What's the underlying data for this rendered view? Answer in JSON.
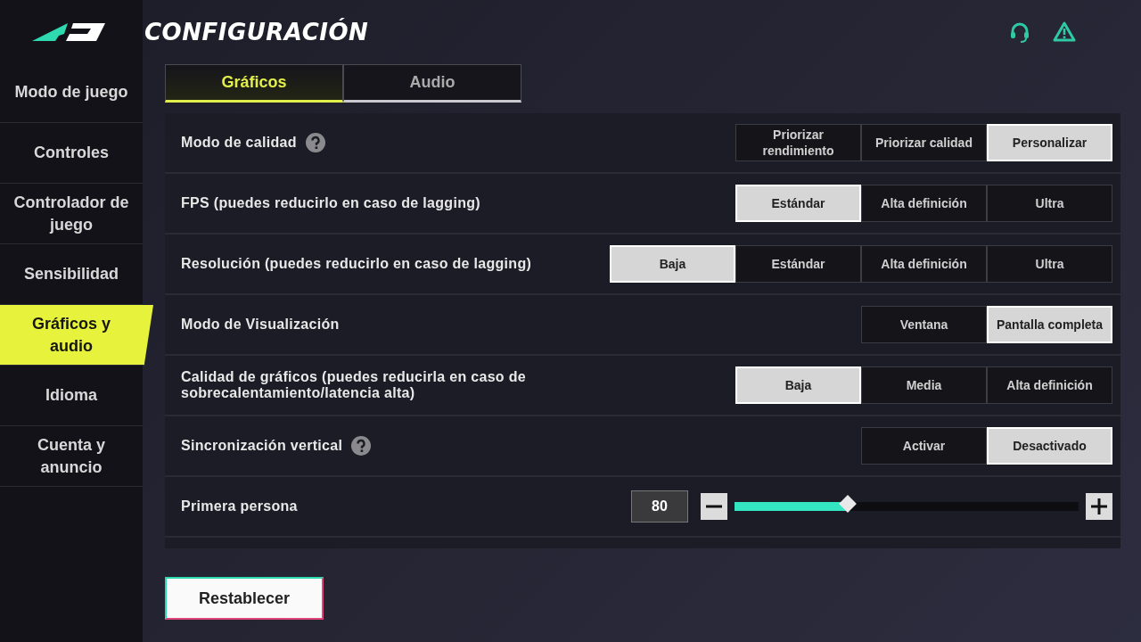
{
  "header": {
    "title": "CONFIGURACIÓN"
  },
  "sidebar": {
    "items": [
      {
        "label": "Modo de juego",
        "selected": false
      },
      {
        "label": "Controles",
        "selected": false
      },
      {
        "label": "Controlador de juego",
        "selected": false
      },
      {
        "label": "Sensibilidad",
        "selected": false
      },
      {
        "label": "Gráficos y audio",
        "selected": true
      },
      {
        "label": "Idioma",
        "selected": false
      },
      {
        "label": "Cuenta y anuncio",
        "selected": false
      }
    ]
  },
  "tabs": [
    {
      "label": "Gráficos",
      "selected": true
    },
    {
      "label": "Audio",
      "selected": false
    }
  ],
  "settings": [
    {
      "kind": "options",
      "label": "Modo de calidad",
      "help": true,
      "options": [
        {
          "label": "Priorizar rendimiento",
          "selected": false
        },
        {
          "label": "Priorizar calidad",
          "selected": false
        },
        {
          "label": "Personalizar",
          "selected": true
        }
      ]
    },
    {
      "kind": "options",
      "label": "FPS (puedes reducirlo en caso de lagging)",
      "options": [
        {
          "label": "Estándar",
          "selected": true
        },
        {
          "label": "Alta definición",
          "selected": false
        },
        {
          "label": "Ultra",
          "selected": false
        }
      ]
    },
    {
      "kind": "options",
      "label": "Resolución (puedes reducirlo en caso de lagging)",
      "options": [
        {
          "label": "Baja",
          "selected": true
        },
        {
          "label": "Estándar",
          "selected": false
        },
        {
          "label": "Alta definición",
          "selected": false
        },
        {
          "label": "Ultra",
          "selected": false
        }
      ]
    },
    {
      "kind": "options",
      "label": "Modo de Visualización",
      "options": [
        {
          "label": "Ventana",
          "selected": false
        },
        {
          "label": "Pantalla completa",
          "selected": true
        }
      ]
    },
    {
      "kind": "options",
      "label": "Calidad de gráficos (puedes reducirla en caso de sobrecalentamiento/latencia alta)",
      "options": [
        {
          "label": "Baja",
          "selected": true
        },
        {
          "label": "Media",
          "selected": false
        },
        {
          "label": "Alta definición",
          "selected": false
        }
      ]
    },
    {
      "kind": "options",
      "label": "Sincronización vertical",
      "help": true,
      "options": [
        {
          "label": "Activar",
          "selected": false
        },
        {
          "label": "Desactivado",
          "selected": true
        }
      ]
    },
    {
      "kind": "slider",
      "label": "Primera persona",
      "value": "80",
      "level": 0.33
    }
  ],
  "reset_button": "Restablecer"
}
